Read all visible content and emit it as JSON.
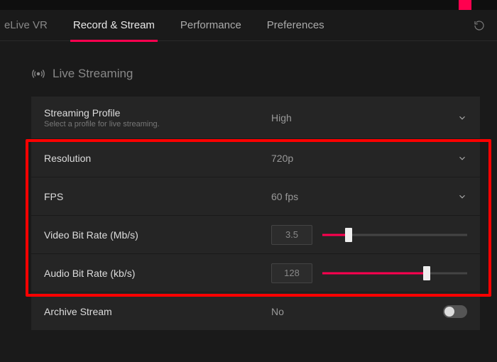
{
  "tabs": {
    "partial": "eLive VR",
    "record_stream": "Record & Stream",
    "performance": "Performance",
    "preferences": "Preferences"
  },
  "section": {
    "title": "Live Streaming"
  },
  "settings": {
    "profile": {
      "label": "Streaming Profile",
      "sublabel": "Select a profile for live streaming.",
      "value": "High"
    },
    "resolution": {
      "label": "Resolution",
      "value": "720p"
    },
    "fps": {
      "label": "FPS",
      "value": "60 fps"
    },
    "video_bitrate": {
      "label": "Video Bit Rate (Mb/s)",
      "value": "3.5",
      "slider_pct": 18
    },
    "audio_bitrate": {
      "label": "Audio Bit Rate (kb/s)",
      "value": "128",
      "slider_pct": 72
    },
    "archive": {
      "label": "Archive Stream",
      "value": "No",
      "enabled": false
    }
  },
  "colors": {
    "accent": "#ff004f"
  }
}
